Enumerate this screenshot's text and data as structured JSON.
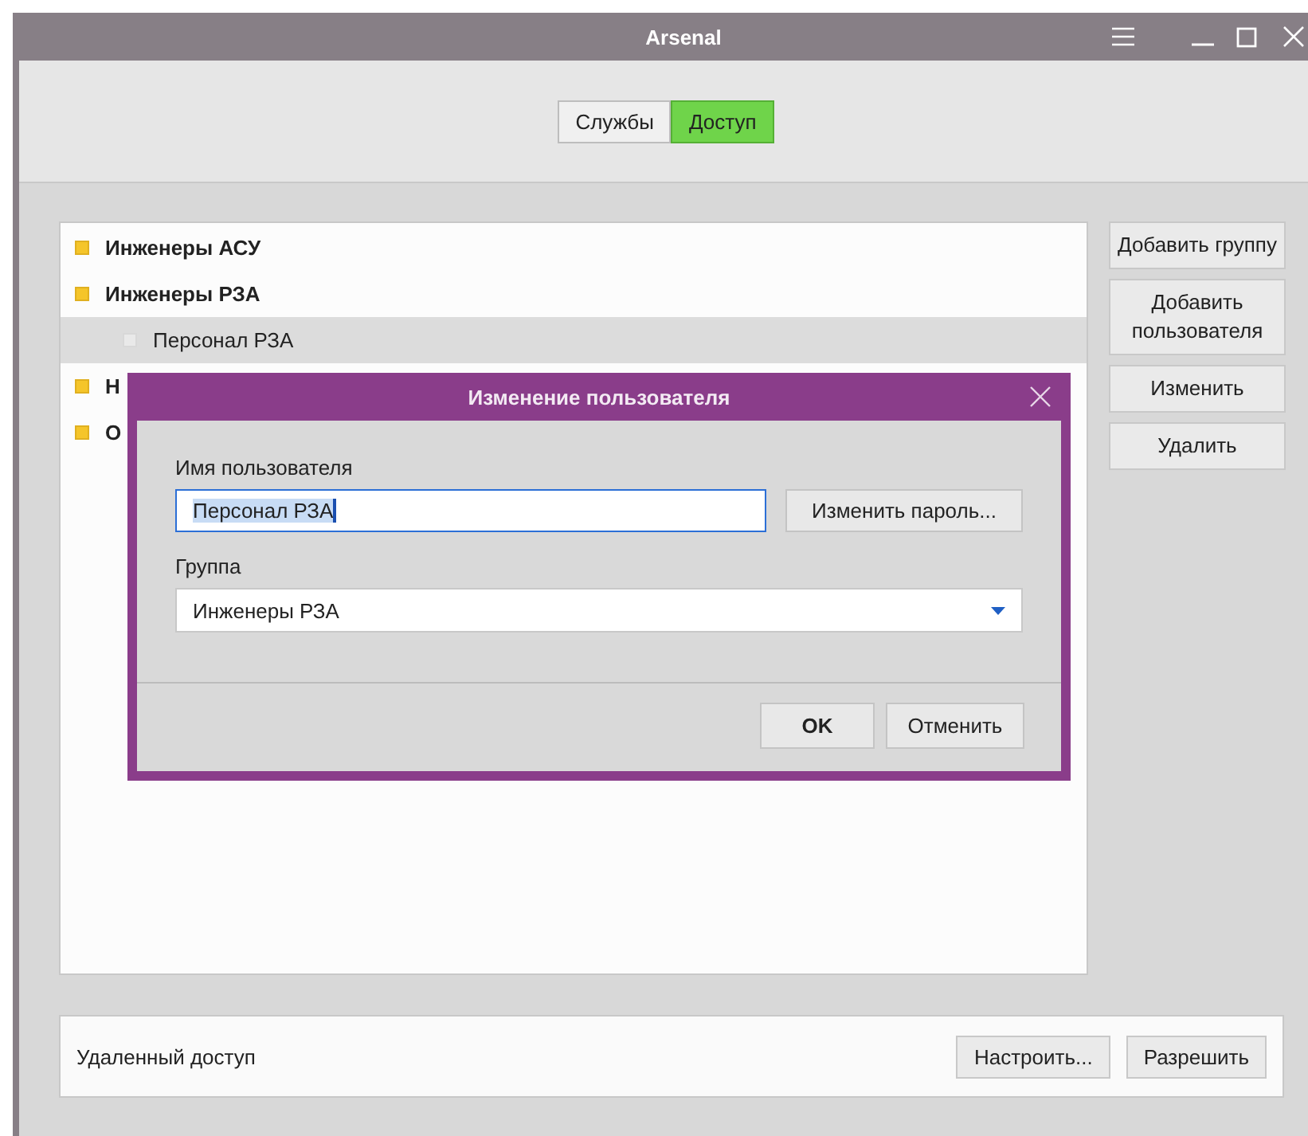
{
  "window": {
    "title": "Arsenal"
  },
  "tabs": [
    {
      "label": "Службы",
      "selected": false
    },
    {
      "label": "Доступ",
      "selected": true
    }
  ],
  "tree": [
    {
      "kind": "group",
      "label": "Инженеры АСУ",
      "selected": false
    },
    {
      "kind": "group",
      "label": "Инженеры РЗА",
      "selected": false,
      "children": [
        {
          "kind": "user",
          "label": "Персонал РЗА",
          "selected": true
        }
      ]
    },
    {
      "kind": "group",
      "label": "Н",
      "selected": false
    },
    {
      "kind": "group",
      "label": "О",
      "selected": false
    }
  ],
  "side_buttons": [
    "Добавить группу",
    "Добавить пользователя",
    "Изменить",
    "Удалить"
  ],
  "remote": {
    "label": "Удаленный доступ",
    "buttons": [
      "Настроить...",
      "Разрешить"
    ]
  },
  "dialog": {
    "title": "Изменение пользователя",
    "name_label": "Имя пользователя",
    "name_value": "Персонал РЗА",
    "password_button": "Изменить пароль...",
    "group_label": "Группа",
    "group_value": "Инженеры РЗА",
    "ok": "OK",
    "cancel": "Отменить"
  }
}
